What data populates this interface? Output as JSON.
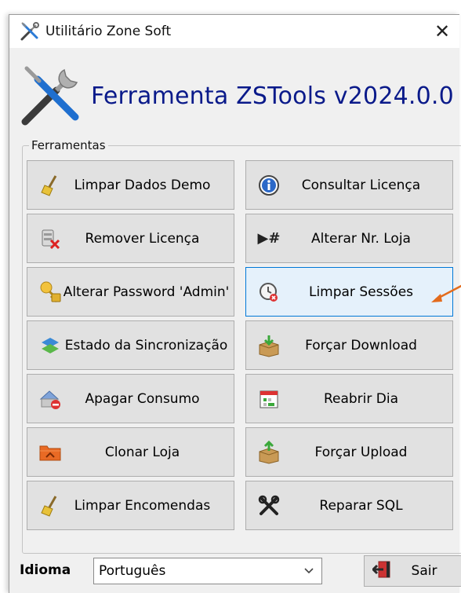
{
  "window": {
    "title": "Utilitário Zone Soft",
    "close_glyph": "✕"
  },
  "header": {
    "title": "Ferramenta ZSTools v2024.0.0",
    "icon": "tools-icon"
  },
  "group": {
    "label": "Ferramentas"
  },
  "buttons": {
    "limpar_dados_demo": {
      "label": "Limpar Dados Demo",
      "icon": "broom-icon"
    },
    "consultar_licenca": {
      "label": "Consultar Licença",
      "icon": "info-icon"
    },
    "remover_licenca": {
      "label": "Remover Licença",
      "icon": "remove-license-icon"
    },
    "alterar_nr_loja": {
      "label": "Alterar Nr. Loja",
      "icon": "play-hash-icon",
      "glyph": "▶#"
    },
    "alterar_password": {
      "label": "Alterar Password 'Admin'",
      "icon": "key-lock-icon"
    },
    "limpar_sessoes": {
      "label": "Limpar Sessões",
      "icon": "clear-sessions-icon"
    },
    "estado_sincronizacao": {
      "label": "Estado da Sincronização",
      "icon": "sync-icon"
    },
    "forcar_download": {
      "label": "Forçar Download",
      "icon": "box-download-icon"
    },
    "apagar_consumo": {
      "label": "Apagar Consumo",
      "icon": "delete-consumption-icon"
    },
    "reabrir_dia": {
      "label": "Reabrir Dia",
      "icon": "calendar-icon"
    },
    "clonar_loja": {
      "label": "Clonar Loja",
      "icon": "folder-icon"
    },
    "forcar_upload": {
      "label": "Forçar Upload",
      "icon": "box-upload-icon"
    },
    "limpar_encomendas": {
      "label": "Limpar Encomendas",
      "icon": "broom-icon"
    },
    "reparar_sql": {
      "label": "Reparar SQL",
      "icon": "wrench-screwdriver-icon"
    }
  },
  "footer": {
    "idioma_label": "Idioma",
    "language_selected": "Português",
    "sair_label": "Sair"
  },
  "colors": {
    "title_blue": "#0a1a8a",
    "active_border": "#0078d7",
    "arrow": "#e36b1c"
  }
}
